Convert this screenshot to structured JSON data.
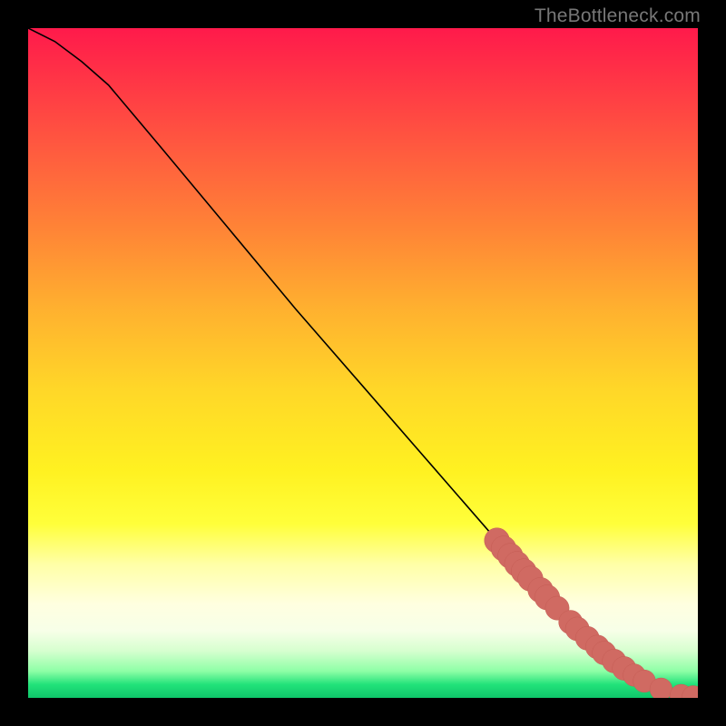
{
  "attribution": "TheBottleneck.com",
  "colors": {
    "frame": "#000000",
    "curve": "#000000",
    "marker_fill": "#d06a62",
    "marker_stroke": "#c55c54",
    "gradient_top": "#ff1a4b",
    "gradient_bottom": "#0fc66a"
  },
  "chart_data": {
    "type": "line",
    "title": "",
    "xlabel": "",
    "ylabel": "",
    "xlim": [
      0,
      100
    ],
    "ylim": [
      0,
      100
    ],
    "curve": {
      "x": [
        0,
        4,
        8,
        12,
        20,
        30,
        40,
        50,
        60,
        70,
        75,
        80,
        84,
        88,
        90,
        92,
        94,
        96,
        98,
        100
      ],
      "y": [
        100,
        98,
        95,
        91.5,
        82,
        70,
        58,
        46.5,
        35,
        23.5,
        18,
        12.5,
        8.5,
        5,
        3.5,
        2.3,
        1.4,
        0.7,
        0.25,
        0.12
      ]
    },
    "markers": [
      {
        "x": 70.0,
        "y": 23.5,
        "r": 1.2
      },
      {
        "x": 71.0,
        "y": 22.3,
        "r": 1.2
      },
      {
        "x": 72.0,
        "y": 21.2,
        "r": 1.2
      },
      {
        "x": 73.0,
        "y": 20.0,
        "r": 1.2
      },
      {
        "x": 74.0,
        "y": 18.9,
        "r": 1.2
      },
      {
        "x": 75.0,
        "y": 17.8,
        "r": 1.2
      },
      {
        "x": 76.5,
        "y": 16.1,
        "r": 1.2
      },
      {
        "x": 77.5,
        "y": 15.0,
        "r": 1.2
      },
      {
        "x": 79.0,
        "y": 13.4,
        "r": 1.1
      },
      {
        "x": 81.0,
        "y": 11.3,
        "r": 1.1
      },
      {
        "x": 82.0,
        "y": 10.3,
        "r": 1.1
      },
      {
        "x": 83.5,
        "y": 8.9,
        "r": 1.1
      },
      {
        "x": 85.0,
        "y": 7.6,
        "r": 1.1
      },
      {
        "x": 86.0,
        "y": 6.7,
        "r": 1.1
      },
      {
        "x": 87.5,
        "y": 5.5,
        "r": 1.1
      },
      {
        "x": 89.0,
        "y": 4.4,
        "r": 1.1
      },
      {
        "x": 90.5,
        "y": 3.4,
        "r": 1.0
      },
      {
        "x": 92.0,
        "y": 2.5,
        "r": 1.0
      },
      {
        "x": 94.5,
        "y": 1.3,
        "r": 1.0
      },
      {
        "x": 97.5,
        "y": 0.35,
        "r": 1.0
      },
      {
        "x": 99.3,
        "y": 0.15,
        "r": 1.0
      }
    ]
  }
}
